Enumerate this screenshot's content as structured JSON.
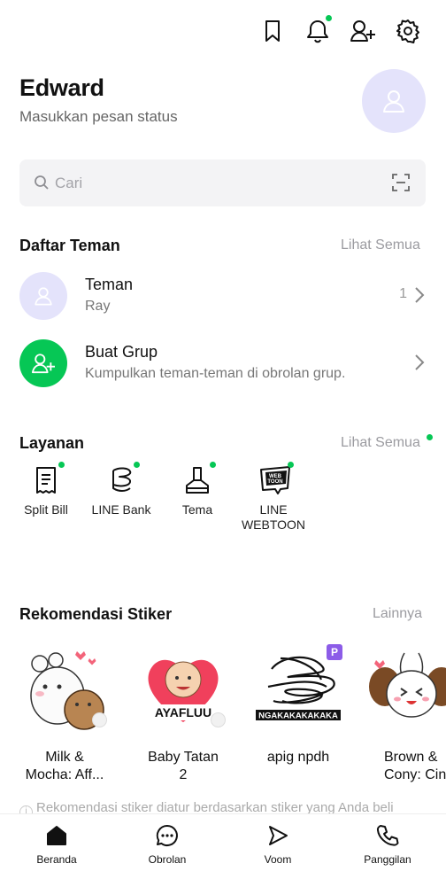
{
  "profile": {
    "name": "Edward",
    "status_placeholder": "Masukkan pesan status"
  },
  "top_icons": [
    "bookmark-icon",
    "bell-icon",
    "add-friend-icon",
    "settings-icon"
  ],
  "search": {
    "placeholder": "Cari"
  },
  "friends": {
    "title": "Daftar Teman",
    "see_all": "Lihat Semua",
    "rows": [
      {
        "title": "Teman",
        "subtitle": "Ray",
        "count": "1"
      },
      {
        "title": "Buat Grup",
        "subtitle": "Kumpulkan teman-teman di obrolan grup."
      }
    ]
  },
  "services": {
    "title": "Layanan",
    "see_all": "Lihat Semua",
    "items": [
      {
        "label": "Split Bill",
        "icon": "receipt-icon"
      },
      {
        "label": "LINE Bank",
        "icon": "bank-icon"
      },
      {
        "label": "Tema",
        "icon": "theme-brush-icon"
      },
      {
        "label": "LINE WEBTOON",
        "icon": "webtoon-icon",
        "icon_text": "WEB TOON"
      }
    ]
  },
  "stickers": {
    "title": "Rekomendasi Stiker",
    "more": "Lainnya",
    "items": [
      {
        "name": "Milk &\nMocha: Aff..."
      },
      {
        "name": "Baby Tatan\n2",
        "caption": "AYAFLUU"
      },
      {
        "name": "apig npdh",
        "caption": "NGAKAKAKAKAKA",
        "badge": "P"
      },
      {
        "name": "Brown &\nCony: Cint"
      }
    ],
    "note": "Rekomendasi stiker diatur berdasarkan stiker yang Anda beli"
  },
  "tabs": [
    {
      "label": "Beranda",
      "icon": "home-icon"
    },
    {
      "label": "Obrolan",
      "icon": "chat-icon"
    },
    {
      "label": "Voom",
      "icon": "voom-icon"
    },
    {
      "label": "Panggilan",
      "icon": "phone-icon"
    }
  ],
  "colors": {
    "accent_green": "#06c755",
    "avatar_lavender": "#e4e3fb",
    "muted_text": "#9b9ba0"
  }
}
